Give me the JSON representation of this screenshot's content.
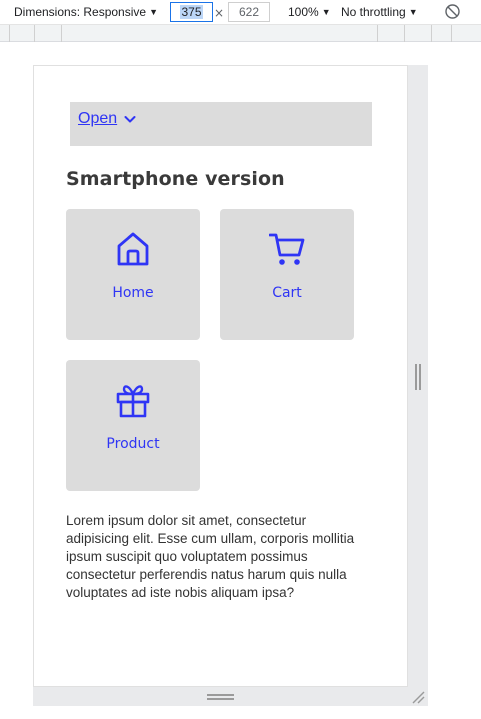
{
  "toolbar": {
    "dimensions_label": "Dimensions: Responsive",
    "width_value": "375",
    "times": "×",
    "height_value": "622",
    "zoom": "100%",
    "throttling": "No throttling"
  },
  "page": {
    "dropdown_label": "Open",
    "heading": "Smartphone version",
    "tiles": [
      {
        "label": "Home",
        "icon": "home-icon"
      },
      {
        "label": "Cart",
        "icon": "cart-icon"
      },
      {
        "label": "Product",
        "icon": "gift-icon"
      }
    ],
    "body_text": "Lorem ipsum dolor sit amet, consectetur adipisicing elit. Esse cum ullam, corporis mollitia ipsum suscipit quo voluptatem possimus consectetur perferendis natus harum quis nulla voluptates ad iste nobis aliquam ipsa?"
  },
  "colors": {
    "accent": "#2f35f5",
    "tile_bg": "#dcdcdc",
    "heading": "#3a3a3a"
  }
}
